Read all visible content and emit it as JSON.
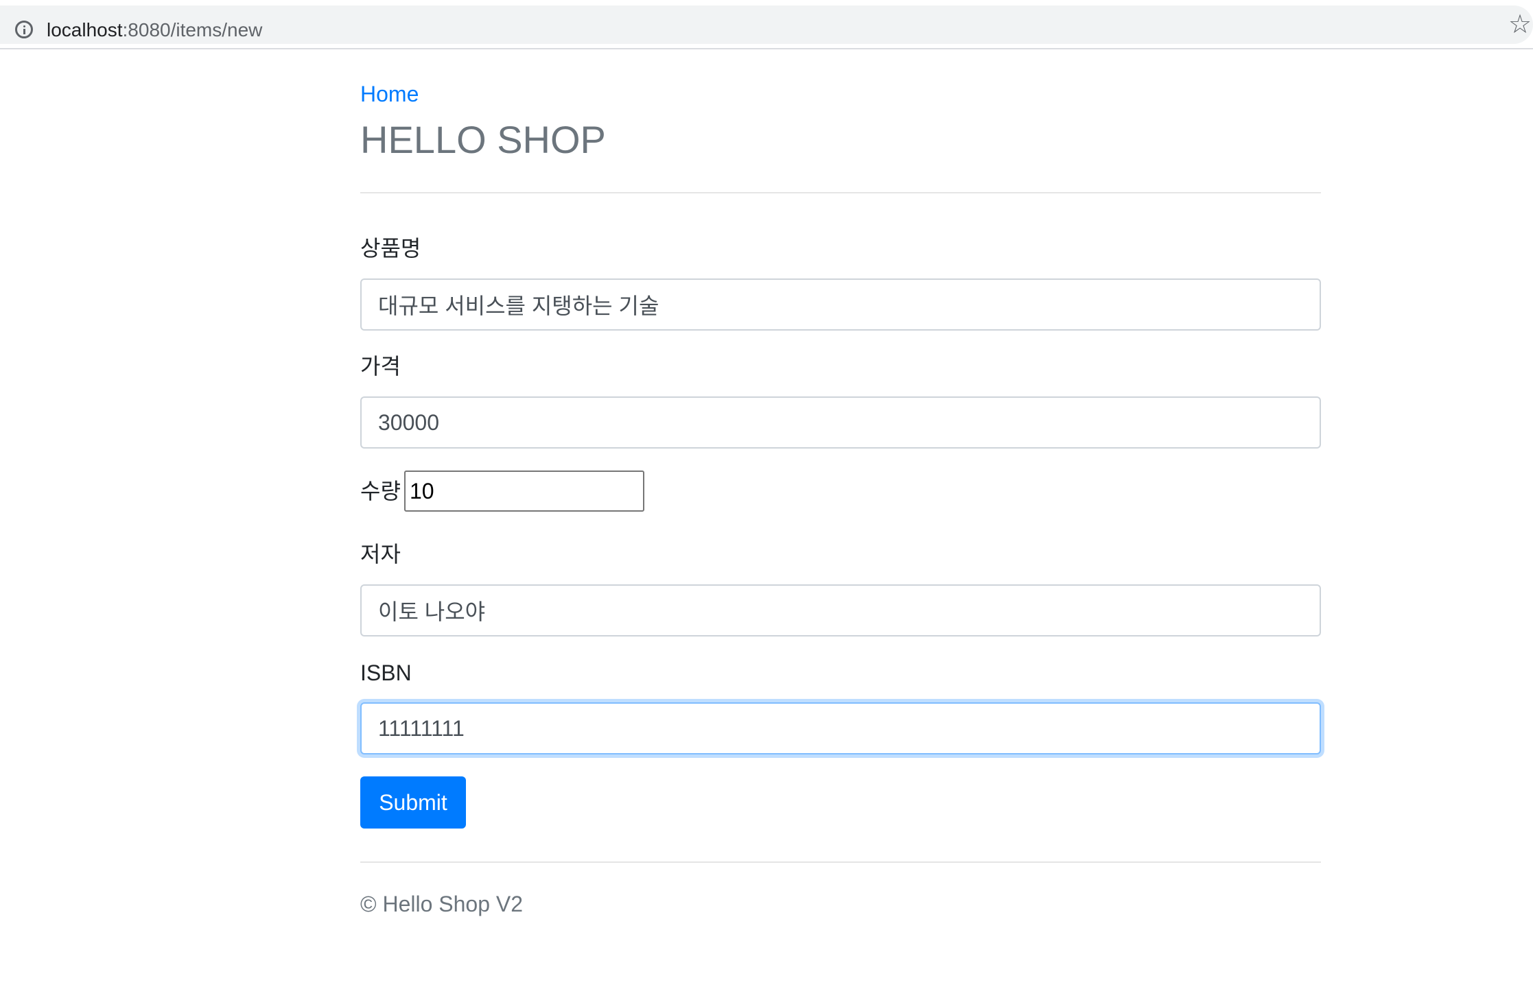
{
  "browser": {
    "url_host": "localhost",
    "url_rest": ":8080/items/new",
    "star_glyph": "☆"
  },
  "header": {
    "home_link": "Home",
    "title": "HELLO SHOP"
  },
  "form": {
    "name_label": "상품명",
    "name_value": "대규모 서비스를 지탱하는 기술",
    "price_label": "가격",
    "price_value": "30000",
    "quantity_label": "수량",
    "quantity_value": "10",
    "author_label": "저자",
    "author_value": "이토 나오야",
    "isbn_label": "ISBN",
    "isbn_value": "11111111",
    "submit_label": "Submit"
  },
  "footer": {
    "text": "© Hello Shop V2"
  },
  "colors": {
    "primary": "#007bff",
    "title_gray": "#6c757d",
    "focus_ring": "#80bdff"
  }
}
